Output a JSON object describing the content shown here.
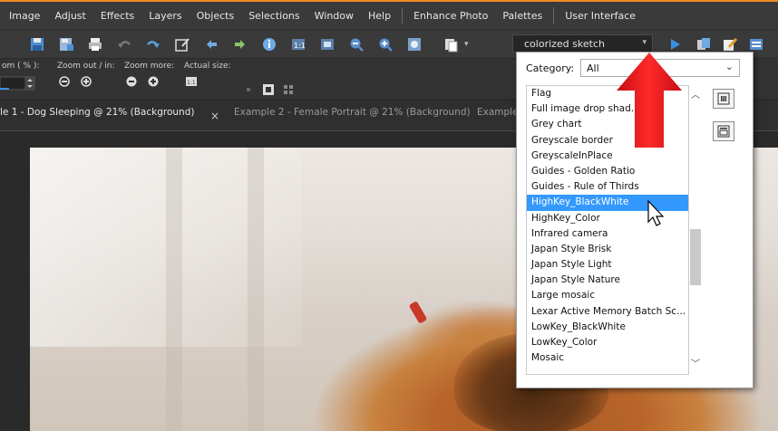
{
  "menubar": {
    "items": [
      "Image",
      "Adjust",
      "Effects",
      "Layers",
      "Objects",
      "Selections",
      "Window",
      "Help",
      "Enhance Photo",
      "Palettes",
      "User Interface"
    ]
  },
  "toolbar": {
    "preset_value": "colorized sketch"
  },
  "zoom_palette": {
    "zoom_percent_label": "om ( % ):",
    "zoom_out_in_label": "Zoom out / in:",
    "zoom_more_label": "Zoom more:",
    "actual_size_label": "Actual size:"
  },
  "tabs": {
    "active": "le 1 - Dog Sleeping @  21% (Background)",
    "close_glyph": "×",
    "inactive": [
      "Example 2 - Female Portrait @  21% (Background)",
      "Example"
    ]
  },
  "popup": {
    "category_label": "Category:",
    "category_value": "All",
    "presets": [
      "Flag",
      "Full image drop shad...",
      "Grey chart",
      "Greyscale border",
      "GreyscaleInPlace",
      "Guides - Golden Ratio",
      "Guides - Rule of Thirds",
      "HighKey_BlackWhite",
      "HighKey_Color",
      "Infrared camera",
      "Japan Style Brisk",
      "Japan Style Light",
      "Japan Style Nature",
      "Large mosaic",
      "Lexar Active Memory Batch Sc...",
      "LowKey_BlackWhite",
      "LowKey_Color",
      "Mosaic"
    ],
    "selected": "HighKey_BlackWhite"
  },
  "colors": {
    "selection": "#3399ff",
    "accent": "#f08a24",
    "arrow": "#e8141c"
  }
}
